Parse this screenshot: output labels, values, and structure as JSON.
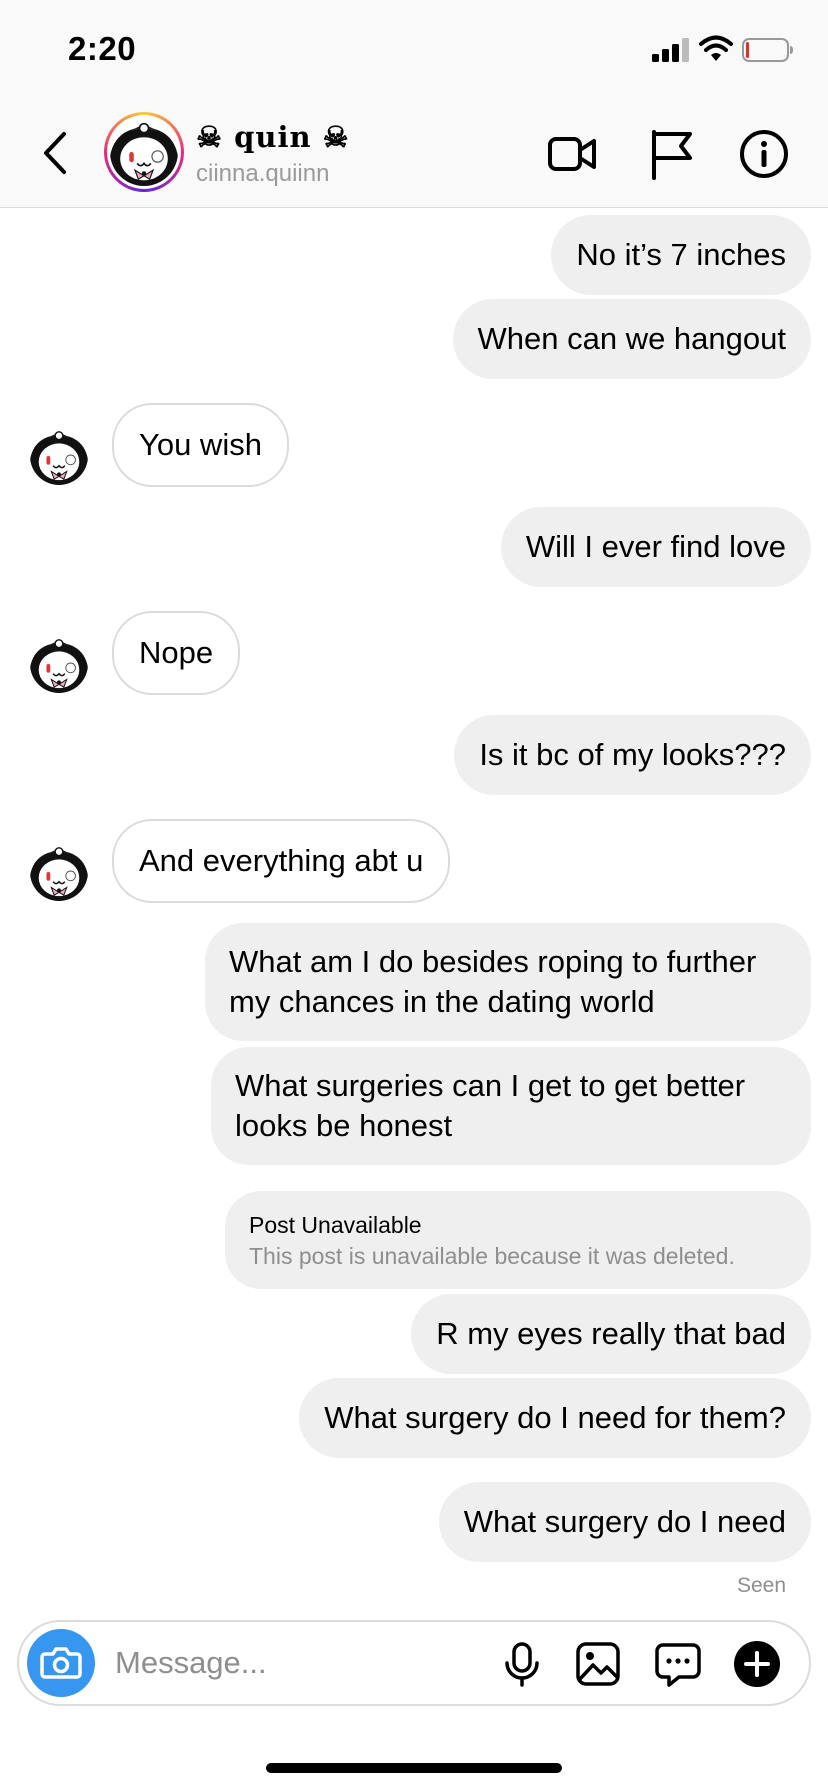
{
  "status_bar": {
    "time": "2:20"
  },
  "header": {
    "contact_name": "☠ quin ☠",
    "contact_username": "ciinna.quiinn"
  },
  "messages": [
    {
      "from": "me",
      "text": "No it’s 7 inches"
    },
    {
      "from": "me",
      "text": "When can we hangout"
    },
    {
      "from": "them",
      "text": "You wish"
    },
    {
      "from": "me",
      "text": "Will I ever find love"
    },
    {
      "from": "them",
      "text": "Nope"
    },
    {
      "from": "me",
      "text": "Is it bc of my looks???"
    },
    {
      "from": "them",
      "text": "And everything abt u"
    },
    {
      "from": "me",
      "text": "What am I do besides roping to further my chances in the dating world"
    },
    {
      "from": "me",
      "text": "What surgeries can I get to get better looks be honest"
    },
    {
      "from": "me",
      "type": "post",
      "title": "Post Unavailable",
      "subtitle": "This post is unavailable because it was deleted."
    },
    {
      "from": "me",
      "text": "R my eyes really that bad"
    },
    {
      "from": "me",
      "text": "What surgery do I need for them?"
    },
    {
      "from": "me",
      "text": "What surgery do I need"
    }
  ],
  "seen_label": "Seen",
  "composer": {
    "placeholder": "Message..."
  },
  "colors": {
    "accent": "#3797f0",
    "sent_bubble": "#efefef",
    "received_border": "#dbdbdb",
    "muted_text": "#8e8e8e"
  }
}
